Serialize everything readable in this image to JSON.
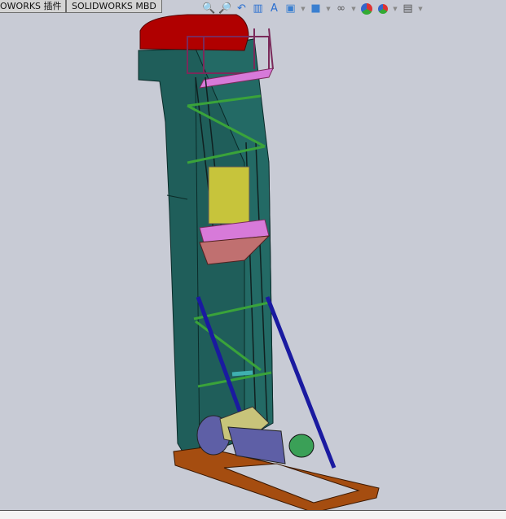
{
  "tabs": [
    {
      "label": "OWORKS 插件"
    },
    {
      "label": "SOLIDWORKS MBD"
    }
  ],
  "toolbar": {
    "icons": [
      "zoom-to-fit-icon",
      "zoom-to-area-icon",
      "previous-view-icon",
      "section-view-icon",
      "dynamic-annotation-icon",
      "view-orientation-icon",
      "display-style-icon",
      "hide-show-items-icon",
      "edit-appearance-icon",
      "apply-scene-icon",
      "view-settings-icon"
    ]
  },
  "model": {
    "colors": {
      "housing": "#1f5e5a",
      "hood": "#b00000",
      "platform": "#d77ad9",
      "hopper": "#c7c43b",
      "braces": "#1a1aa0",
      "frame": "#a54d10",
      "motor": "#5e5fa6",
      "gearbox": "#c8c47a",
      "motor_end": "#3aa057",
      "railing": "#7a2a5a",
      "catwalk": "#3aa33a"
    }
  }
}
